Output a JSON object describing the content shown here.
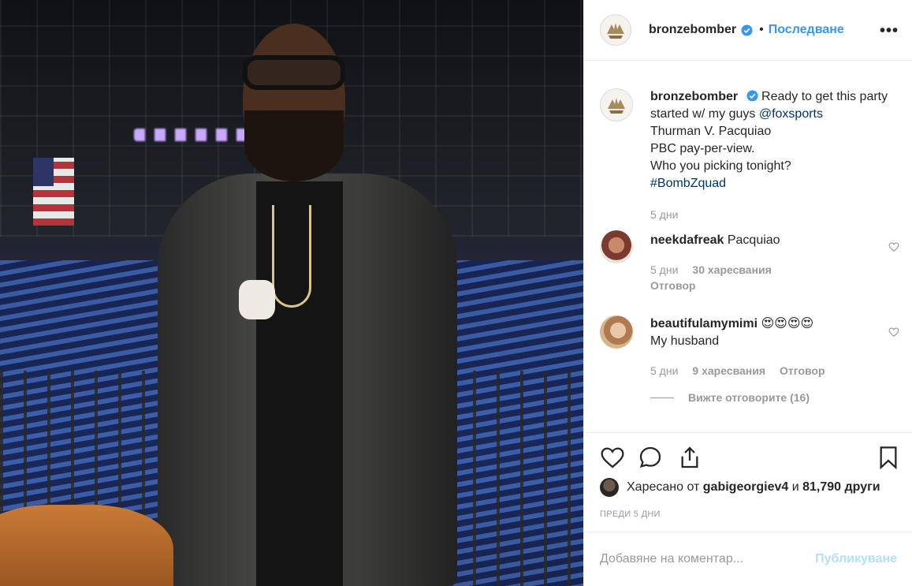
{
  "header": {
    "username": "bronzebomber",
    "dot": "•",
    "follow_label": "Последване",
    "more_label": "•••"
  },
  "caption": {
    "username": "bronzebomber",
    "text_1": "Ready to get this party started w/ my guys",
    "mention": "@foxsports",
    "line_2": "Thurman V. Pacquiao",
    "line_3": "PBC pay-per-view.",
    "line_4": "Who you picking tonight?",
    "hashtag": "#BombZquad",
    "time": "5 дни"
  },
  "comments": [
    {
      "username": "neekdafreak",
      "text": "Pacquiao",
      "time": "5 дни",
      "likes": "30 харесвания",
      "reply": "Отговор"
    },
    {
      "username": "beautifulamymimi",
      "emoji": "😍😍😍😍",
      "text": "My husband",
      "time": "5 дни",
      "likes": "9 харесвания",
      "reply": "Отговор",
      "view_replies": "Вижте отговорите (16)"
    }
  ],
  "likes_line": {
    "prefix": "Харесано от",
    "user": "gabigeorgiev4",
    "middle": "и",
    "count": "81,790 други"
  },
  "timestamp": "ПРЕДИ 5 ДНИ",
  "add_comment": {
    "placeholder": "Добавяне на коментар...",
    "publish_label": "Публикуване"
  },
  "colors": {
    "link": "#003569",
    "follow": "#3897f0",
    "muted": "#999999"
  },
  "icons": [
    "heart-icon",
    "comment-icon",
    "share-icon",
    "bookmark-icon",
    "verified-icon",
    "more-icon"
  ]
}
